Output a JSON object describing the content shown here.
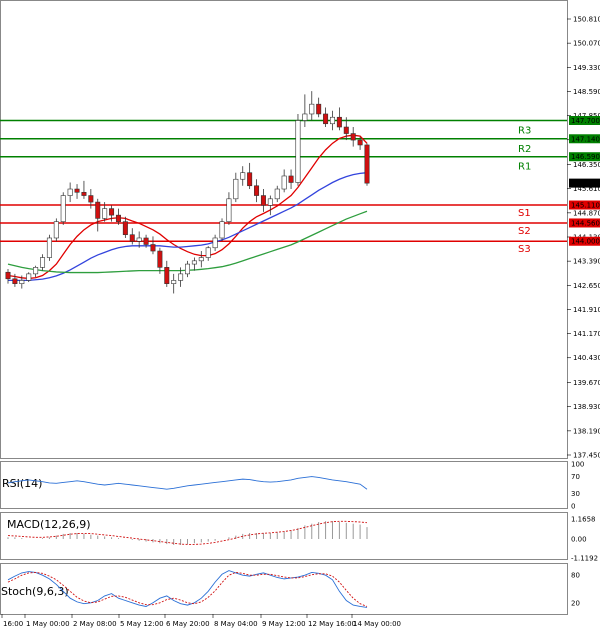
{
  "chart_data": {
    "type": "candlestick",
    "price_axis": {
      "min": 137.45,
      "max": 151.3,
      "ticks": [
        "150.810",
        "150.070",
        "149.330",
        "148.590",
        "147.850",
        "147.110",
        "146.350",
        "145.610",
        "144.870",
        "144.130",
        "143.390",
        "142.650",
        "141.910",
        "141.170",
        "140.430",
        "139.670",
        "138.930",
        "138.190",
        "137.450"
      ],
      "tick_values": [
        150.81,
        150.07,
        149.33,
        148.59,
        147.85,
        147.11,
        146.35,
        145.61,
        144.87,
        144.13,
        143.39,
        142.65,
        141.91,
        141.17,
        140.43,
        139.67,
        138.93,
        138.19,
        137.45
      ]
    },
    "x_axis_labels": [
      "16:00",
      "1 May 00:00",
      "2 May 08:00",
      "5 May 12:00",
      "6 May 20:00",
      "8 May 04:00",
      "9 May 12:00",
      "12 May 16:00",
      "14 May 00:00"
    ],
    "levels": [
      {
        "name": "R3",
        "value": 147.7,
        "label": "147.700",
        "color": "#008000"
      },
      {
        "name": "R2",
        "value": 147.14,
        "label": "147.140",
        "color": "#008000"
      },
      {
        "name": "R1",
        "value": 146.59,
        "label": "146.590",
        "color": "#008000"
      },
      {
        "name": "S1",
        "value": 145.11,
        "label": "145.110",
        "color": "#e00000"
      },
      {
        "name": "S2",
        "value": 144.56,
        "label": "144.560",
        "color": "#e00000"
      },
      {
        "name": "S3",
        "value": 144.0,
        "label": "144.000",
        "color": "#e00000"
      }
    ],
    "current_price": {
      "value": 145.781,
      "label": "145.781"
    },
    "candles": [
      [
        143.05,
        143.15,
        142.7,
        142.85
      ],
      [
        142.85,
        143.0,
        142.6,
        142.7
      ],
      [
        142.7,
        142.95,
        142.55,
        142.8
      ],
      [
        142.8,
        143.05,
        142.75,
        143.0
      ],
      [
        143.0,
        143.25,
        142.9,
        143.2
      ],
      [
        143.2,
        143.6,
        143.1,
        143.5
      ],
      [
        143.5,
        144.2,
        143.4,
        144.1
      ],
      [
        144.1,
        144.7,
        144.0,
        144.6
      ],
      [
        144.6,
        145.5,
        144.5,
        145.4
      ],
      [
        145.4,
        145.8,
        145.2,
        145.6
      ],
      [
        145.6,
        145.75,
        145.3,
        145.5
      ],
      [
        145.5,
        145.85,
        145.3,
        145.4
      ],
      [
        145.4,
        145.6,
        145.0,
        145.2
      ],
      [
        145.2,
        145.3,
        144.3,
        144.7
      ],
      [
        144.7,
        145.2,
        144.6,
        145.0
      ],
      [
        145.0,
        145.1,
        144.6,
        144.8
      ],
      [
        144.8,
        145.0,
        144.5,
        144.6
      ],
      [
        144.6,
        144.75,
        144.1,
        144.2
      ],
      [
        144.2,
        144.4,
        143.9,
        144.0
      ],
      [
        144.0,
        144.3,
        143.8,
        144.1
      ],
      [
        144.1,
        144.2,
        143.8,
        143.9
      ],
      [
        143.9,
        144.15,
        143.6,
        143.7
      ],
      [
        143.7,
        143.8,
        143.0,
        143.2
      ],
      [
        143.2,
        143.4,
        142.6,
        142.7
      ],
      [
        142.7,
        143.0,
        142.4,
        142.8
      ],
      [
        142.8,
        143.2,
        142.6,
        143.0
      ],
      [
        143.0,
        143.4,
        142.9,
        143.3
      ],
      [
        143.3,
        143.5,
        143.1,
        143.4
      ],
      [
        143.4,
        143.7,
        143.2,
        143.5
      ],
      [
        143.5,
        143.85,
        143.4,
        143.8
      ],
      [
        143.8,
        144.2,
        143.7,
        144.1
      ],
      [
        144.1,
        144.7,
        144.0,
        144.6
      ],
      [
        144.6,
        145.5,
        144.5,
        145.3
      ],
      [
        145.3,
        146.1,
        145.2,
        145.9
      ],
      [
        145.9,
        146.3,
        145.7,
        146.1
      ],
      [
        146.1,
        146.4,
        145.6,
        145.7
      ],
      [
        145.7,
        145.9,
        145.2,
        145.4
      ],
      [
        145.4,
        145.6,
        144.9,
        145.1
      ],
      [
        145.1,
        145.4,
        144.8,
        145.3
      ],
      [
        145.3,
        145.7,
        145.2,
        145.6
      ],
      [
        145.6,
        146.2,
        145.5,
        146.0
      ],
      [
        146.0,
        146.2,
        145.6,
        145.8
      ],
      [
        145.8,
        147.9,
        145.7,
        147.7
      ],
      [
        147.7,
        148.5,
        147.5,
        147.9
      ],
      [
        147.9,
        148.6,
        147.7,
        148.2
      ],
      [
        148.2,
        148.4,
        147.8,
        147.9
      ],
      [
        147.9,
        148.1,
        147.5,
        147.6
      ],
      [
        147.6,
        148.0,
        147.4,
        147.8
      ],
      [
        147.8,
        148.1,
        147.4,
        147.5
      ],
      [
        147.5,
        147.8,
        147.1,
        147.3
      ],
      [
        147.3,
        147.5,
        146.9,
        147.1
      ],
      [
        147.1,
        147.2,
        146.8,
        146.95
      ],
      [
        146.95,
        147.0,
        145.7,
        145.78
      ]
    ],
    "moving_averages": [
      {
        "name": "fast",
        "color": "#e00000",
        "values": [
          142.95,
          142.92,
          142.88,
          142.86,
          142.88,
          142.95,
          143.1,
          143.3,
          143.6,
          143.9,
          144.15,
          144.35,
          144.5,
          144.6,
          144.65,
          144.7,
          144.72,
          144.7,
          144.62,
          144.55,
          144.45,
          144.35,
          144.22,
          144.05,
          143.9,
          143.78,
          143.68,
          143.6,
          143.56,
          143.56,
          143.62,
          143.74,
          143.92,
          144.15,
          144.4,
          144.6,
          144.75,
          144.85,
          144.96,
          145.08,
          145.24,
          145.4,
          145.65,
          145.95,
          146.25,
          146.55,
          146.8,
          147.0,
          147.15,
          147.22,
          147.25,
          147.22,
          147.0
        ]
      },
      {
        "name": "mid",
        "color": "#3344dd",
        "values": [
          142.8,
          142.8,
          142.8,
          142.8,
          142.82,
          142.84,
          142.88,
          142.94,
          143.02,
          143.12,
          143.24,
          143.36,
          143.48,
          143.58,
          143.66,
          143.74,
          143.8,
          143.84,
          143.86,
          143.86,
          143.86,
          143.86,
          143.86,
          143.84,
          143.82,
          143.82,
          143.84,
          143.86,
          143.88,
          143.92,
          143.98,
          144.04,
          144.12,
          144.22,
          144.32,
          144.42,
          144.52,
          144.62,
          144.72,
          144.82,
          144.92,
          145.02,
          145.14,
          145.28,
          145.42,
          145.56,
          145.68,
          145.8,
          145.9,
          145.98,
          146.04,
          146.08,
          146.1
        ]
      },
      {
        "name": "slow",
        "color": "#2e9e3e",
        "values": [
          143.3,
          143.25,
          143.2,
          143.16,
          143.13,
          143.1,
          143.08,
          143.06,
          143.05,
          143.04,
          143.04,
          143.04,
          143.04,
          143.04,
          143.05,
          143.06,
          143.07,
          143.08,
          143.09,
          143.1,
          143.1,
          143.1,
          143.1,
          143.1,
          143.1,
          143.1,
          143.11,
          143.12,
          143.14,
          143.16,
          143.19,
          143.22,
          143.27,
          143.33,
          143.4,
          143.47,
          143.54,
          143.61,
          143.68,
          143.75,
          143.82,
          143.89,
          143.98,
          144.08,
          144.18,
          144.28,
          144.38,
          144.48,
          144.58,
          144.68,
          144.76,
          144.84,
          144.92
        ]
      }
    ],
    "indicators": [
      {
        "name": "RSI(14)",
        "scale": [
          "100",
          "70",
          "30",
          "0"
        ],
        "values": [
          55,
          58,
          60,
          62,
          60,
          58,
          55,
          54,
          56,
          58,
          60,
          58,
          55,
          52,
          50,
          52,
          54,
          52,
          50,
          48,
          46,
          44,
          42,
          40,
          42,
          45,
          48,
          50,
          52,
          54,
          56,
          58,
          60,
          62,
          64,
          63,
          60,
          58,
          57,
          58,
          60,
          62,
          66,
          68,
          70,
          68,
          65,
          62,
          60,
          58,
          55,
          52,
          40
        ]
      },
      {
        "name": "MACD(12,26,9)",
        "scale": [
          "1.1658",
          "0.00",
          "-1.1192"
        ],
        "histogram": [
          0.1,
          0.1,
          0.05,
          0.0,
          0.0,
          0.05,
          0.1,
          0.2,
          0.3,
          0.35,
          0.35,
          0.3,
          0.25,
          0.2,
          0.15,
          0.1,
          0.05,
          0.0,
          -0.05,
          -0.1,
          -0.15,
          -0.2,
          -0.25,
          -0.3,
          -0.35,
          -0.35,
          -0.3,
          -0.25,
          -0.2,
          -0.15,
          -0.1,
          0.0,
          0.1,
          0.2,
          0.3,
          0.35,
          0.35,
          0.35,
          0.35,
          0.4,
          0.45,
          0.5,
          0.65,
          0.8,
          0.9,
          1.0,
          1.05,
          1.05,
          1.0,
          0.95,
          0.9,
          0.85,
          0.7
        ],
        "signal": [
          0.2,
          0.18,
          0.15,
          0.12,
          0.1,
          0.1,
          0.12,
          0.16,
          0.22,
          0.28,
          0.32,
          0.33,
          0.32,
          0.28,
          0.24,
          0.2,
          0.15,
          0.1,
          0.05,
          0.0,
          -0.05,
          -0.1,
          -0.15,
          -0.2,
          -0.25,
          -0.3,
          -0.32,
          -0.32,
          -0.3,
          -0.26,
          -0.2,
          -0.12,
          -0.04,
          0.06,
          0.16,
          0.24,
          0.3,
          0.34,
          0.36,
          0.4,
          0.44,
          0.5,
          0.58,
          0.68,
          0.78,
          0.88,
          0.96,
          1.02,
          1.04,
          1.04,
          1.02,
          1.0,
          0.96
        ]
      },
      {
        "name": "Stoch(9,6,3)",
        "scale": [
          "80",
          "20"
        ],
        "main": [
          70,
          78,
          85,
          88,
          86,
          80,
          72,
          60,
          45,
          30,
          22,
          18,
          20,
          25,
          35,
          40,
          30,
          25,
          20,
          15,
          12,
          20,
          30,
          35,
          25,
          18,
          15,
          20,
          30,
          45,
          65,
          82,
          90,
          85,
          80,
          78,
          82,
          85,
          80,
          75,
          72,
          74,
          76,
          80,
          86,
          84,
          80,
          70,
          45,
          25,
          15,
          12,
          10
        ],
        "signal": [
          65,
          72,
          80,
          85,
          86,
          84,
          78,
          70,
          58,
          45,
          32,
          24,
          20,
          22,
          28,
          34,
          35,
          32,
          26,
          20,
          16,
          16,
          20,
          27,
          30,
          26,
          20,
          18,
          22,
          32,
          46,
          64,
          80,
          86,
          84,
          80,
          80,
          82,
          82,
          79,
          76,
          74,
          74,
          77,
          81,
          83,
          83,
          78,
          65,
          47,
          30,
          18,
          12
        ]
      }
    ]
  }
}
